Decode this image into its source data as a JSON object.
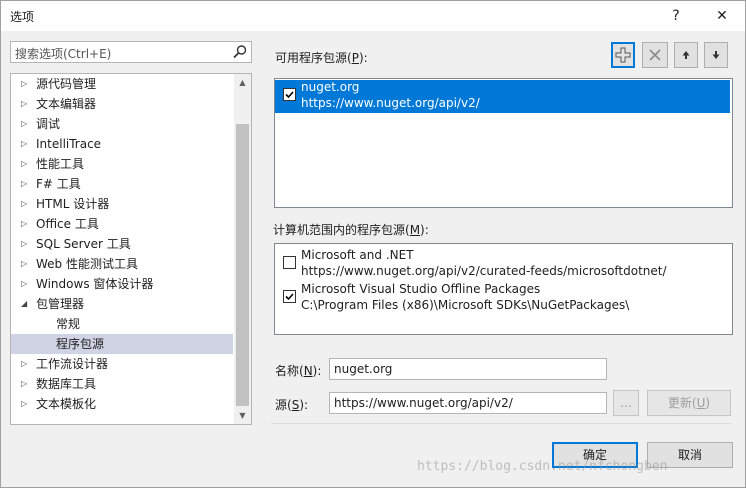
{
  "window": {
    "title": "选项",
    "help_glyph": "?",
    "close_glyph": "✕"
  },
  "search": {
    "placeholder": "搜索选项(Ctrl+E)"
  },
  "tree": {
    "items": [
      {
        "label": "源代码管理",
        "expanded": false
      },
      {
        "label": "文本编辑器",
        "expanded": false
      },
      {
        "label": "调试",
        "expanded": false
      },
      {
        "label": "IntelliTrace",
        "expanded": false
      },
      {
        "label": "性能工具",
        "expanded": false
      },
      {
        "label": "F# 工具",
        "expanded": false
      },
      {
        "label": "HTML 设计器",
        "expanded": false
      },
      {
        "label": "Office 工具",
        "expanded": false
      },
      {
        "label": "SQL Server 工具",
        "expanded": false
      },
      {
        "label": "Web 性能测试工具",
        "expanded": false
      },
      {
        "label": "Windows 窗体设计器",
        "expanded": false
      },
      {
        "label": "包管理器",
        "expanded": true
      },
      {
        "label": "常规",
        "child": true
      },
      {
        "label": "程序包源",
        "child": true,
        "selected": true
      },
      {
        "label": "工作流设计器",
        "expanded": false
      },
      {
        "label": "数据库工具",
        "expanded": false
      },
      {
        "label": "文本模板化",
        "expanded": false
      }
    ]
  },
  "available_sources": {
    "label_prefix": "可用程序包源(",
    "label_key": "P",
    "label_suffix": "):",
    "items": [
      {
        "name": "nuget.org",
        "url": "https://www.nuget.org/api/v2/",
        "checked": true,
        "selected": true
      }
    ]
  },
  "toolbar": {
    "add_icon": "plus-icon",
    "remove_icon": "delete-x-icon",
    "up_icon": "arrow-up-icon",
    "down_icon": "arrow-down-icon"
  },
  "machine_sources": {
    "label_prefix": "计算机范围内的程序包源(",
    "label_key": "M",
    "label_suffix": "):",
    "items": [
      {
        "name": "Microsoft and .NET",
        "url": "https://www.nuget.org/api/v2/curated-feeds/microsoftdotnet/",
        "checked": false
      },
      {
        "name": "Microsoft Visual Studio Offline Packages",
        "url": "C:\\Program Files (x86)\\Microsoft SDKs\\NuGetPackages\\",
        "checked": true
      }
    ]
  },
  "form": {
    "name_label_prefix": "名称(",
    "name_label_key": "N",
    "name_label_suffix": "):",
    "name_value": "nuget.org",
    "source_label_prefix": "源(",
    "source_label_key": "S",
    "source_label_suffix": "):",
    "source_value": "https://www.nuget.org/api/v2/",
    "browse_label": "...",
    "update_label_prefix": "更新(",
    "update_label_key": "U",
    "update_label_suffix": ")"
  },
  "footer": {
    "ok_label": "确定",
    "cancel_label": "取消"
  },
  "watermark": "https://blog.csdn.net/nfchongben",
  "colors": {
    "accent": "#0078d7",
    "tree_selected": "#cfd3e3"
  }
}
